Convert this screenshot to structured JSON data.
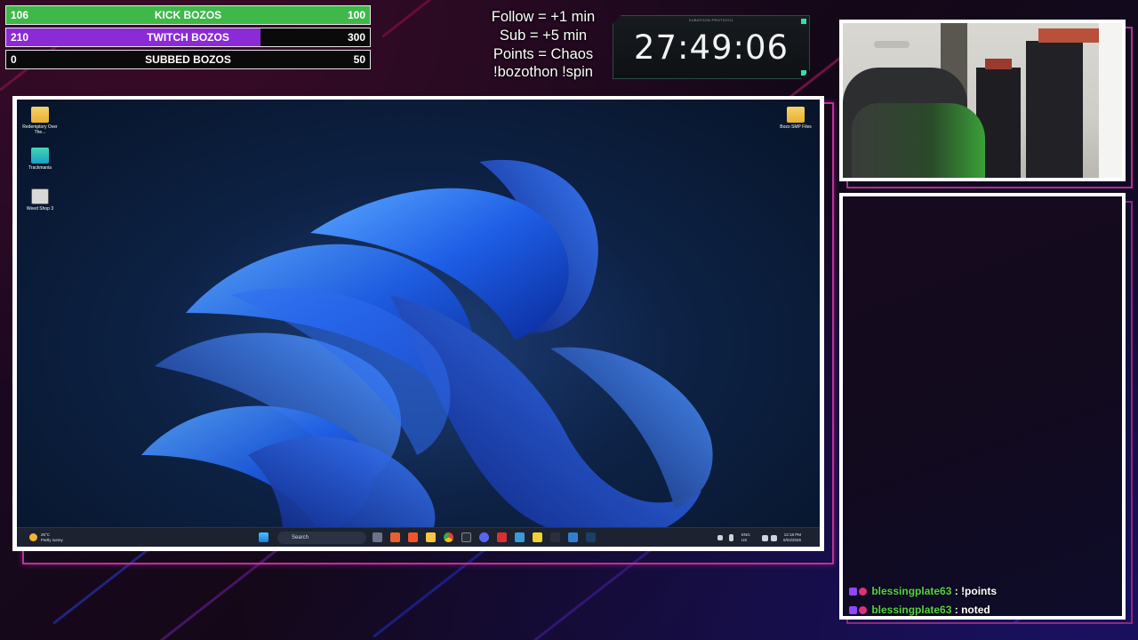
{
  "overlay": {
    "bars": [
      {
        "left": "106",
        "label": "KICK BOZOS",
        "right": "100",
        "fill_fraction": 1.0,
        "color": "#3fb84a"
      },
      {
        "left": "210",
        "label": "TWITCH BOZOS",
        "right": "300",
        "fill_fraction": 0.7,
        "color": "#8a2bd6"
      },
      {
        "left": "0",
        "label": "SUBBED BOZOS",
        "right": "50",
        "fill_fraction": 0.0,
        "color": "#3fb84a"
      }
    ],
    "rules": [
      "Follow = +1 min",
      "Sub = +5 min",
      "Points = Chaos",
      "!bozothon !spin"
    ],
    "timer": {
      "caption": "SUBATHON PROTOCOL",
      "time": "27:49:06",
      "accent": "#2fe0a8"
    }
  },
  "desktop": {
    "icons": [
      {
        "label": "Redemptory Over The...",
        "icon": "folder-icon"
      },
      {
        "label": "Trackmania",
        "icon": "trackmania-icon"
      },
      {
        "label": "Weed Shop 3",
        "icon": "weed-shop-icon"
      },
      {
        "label": "Bozo SMP Files",
        "icon": "folder-icon"
      }
    ],
    "taskbar": {
      "weather_temp": "26°C",
      "weather_desc": "Partly sunny",
      "search_placeholder": "Search",
      "lang": "ENG",
      "region": "US",
      "time": "12:18 PM",
      "date": "6/04/2026"
    }
  },
  "chat": {
    "messages": [
      {
        "user": "blessingplate63",
        "text": "!points"
      },
      {
        "user": "blessingplate63",
        "text": "noted"
      }
    ],
    "username_color": "#55d43e"
  }
}
